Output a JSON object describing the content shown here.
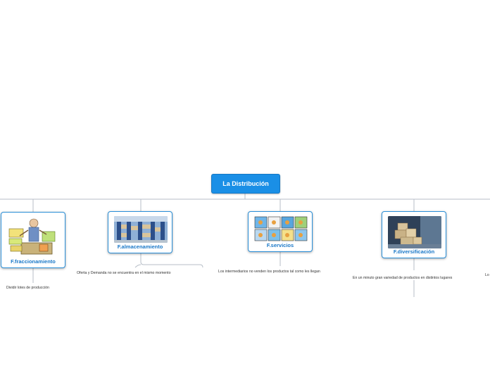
{
  "root": {
    "label": "La Distribución"
  },
  "branches": [
    {
      "label": "F.fraccionamiento",
      "image_icon": "vendor-illustration-icon",
      "note": "Dividir lotes de producción"
    },
    {
      "label": "F.almacenamiento",
      "image_icon": "warehouse-photo-icon",
      "note": "Oferta y Demanda no se encuentra en el mismo momento"
    },
    {
      "label": "F.servicios",
      "image_icon": "services-collage-icon",
      "note": "Los intermediarios no venden los productos tal como les llegan"
    },
    {
      "label": "F.diversificación",
      "image_icon": "boxes-photo-icon",
      "note": "En un minuto gran variedad de productos en distintos lugares"
    },
    {
      "note": "Lo"
    }
  ],
  "colors": {
    "root_bg": "#1a8fe6",
    "node_border": "#2a8fd8",
    "label": "#1a78c8",
    "connector": "#b7bec7"
  }
}
